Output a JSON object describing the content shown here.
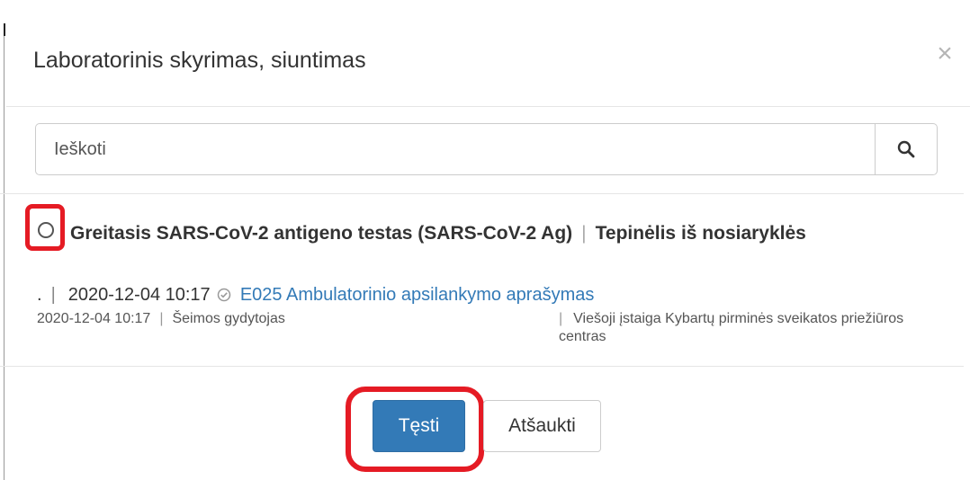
{
  "modal": {
    "title": "Laboratorinis skyrimas, siuntimas",
    "close_symbol": "×"
  },
  "search": {
    "placeholder": "Ieškoti",
    "icon": "search-icon"
  },
  "item": {
    "selected": false,
    "title": "Greitasis SARS-CoV-2 antigeno testas (SARS-CoV-2 Ag)",
    "separator": "|",
    "specimen": "Tepinėlis iš nosiaryklės",
    "meta_prefix": ".",
    "meta_datetime": "2020-12-04 10:17",
    "status_icon": "check-circle-icon",
    "document_link": "E025 Ambulatorinio apsilankymo aprašymas",
    "detail_datetime": "2020-12-04 10:17",
    "detail_role": "Šeimos gydytojas",
    "detail_institution": "Viešoji įstaiga Kybartų pirminės sveikatos priežiūros centras"
  },
  "footer": {
    "continue_label": "Tęsti",
    "cancel_label": "Atšaukti"
  },
  "colors": {
    "primary": "#337ab7",
    "highlight": "#e51b24",
    "link": "#337ab7"
  }
}
